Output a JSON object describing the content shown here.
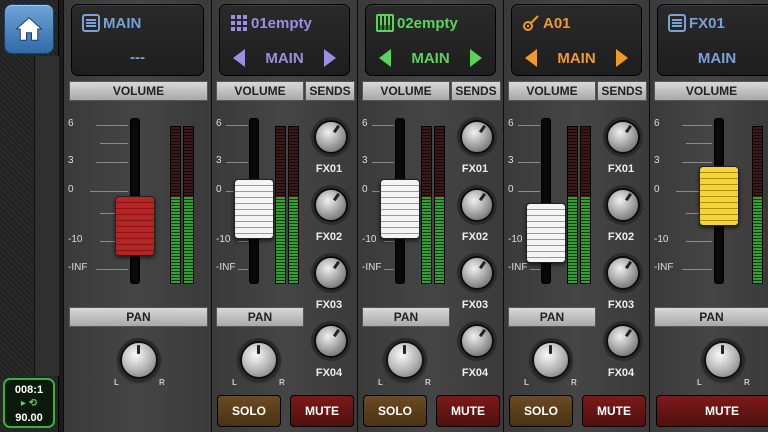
{
  "left_rail": {
    "home_icon": "home-icon",
    "counter": {
      "position": "008:1",
      "loop_symbol": "▸ ⟲",
      "tempo": "90.00"
    }
  },
  "labels": {
    "volume": "VOLUME",
    "sends": "SENDS",
    "pan": "PAN",
    "solo": "SOLO",
    "mute": "MUTE",
    "pan_left": "L",
    "pan_right": "R"
  },
  "scale": [
    "6",
    "3",
    "0",
    "-10",
    "-INF"
  ],
  "send_names": [
    "FX01",
    "FX02",
    "FX03",
    "FX04"
  ],
  "channels": [
    {
      "name": "MAIN",
      "route": "---",
      "icon": "list-icon",
      "color": "#7aa0d6",
      "fader_color": "red"
    },
    {
      "name": "01empty",
      "route": "MAIN",
      "icon": "pad-grid-icon",
      "color": "#9b8fe0",
      "fader_color": "white"
    },
    {
      "name": "02empty",
      "route": "MAIN",
      "icon": "keyboard-icon",
      "color": "#5bd35b",
      "fader_color": "white"
    },
    {
      "name": "A01",
      "route": "MAIN",
      "icon": "guitar-icon",
      "color": "#f09a2a",
      "fader_color": "white"
    },
    {
      "name": "FX01",
      "route": "MAIN",
      "icon": "list-icon",
      "color": "#7aa0d6",
      "fader_color": "yellow"
    }
  ],
  "colors": {
    "main": "#7aa0d6",
    "drum": "#9b8fe0",
    "keys": "#5bd35b",
    "guitar": "#f09a2a",
    "counter_border": "#3fae3f"
  }
}
